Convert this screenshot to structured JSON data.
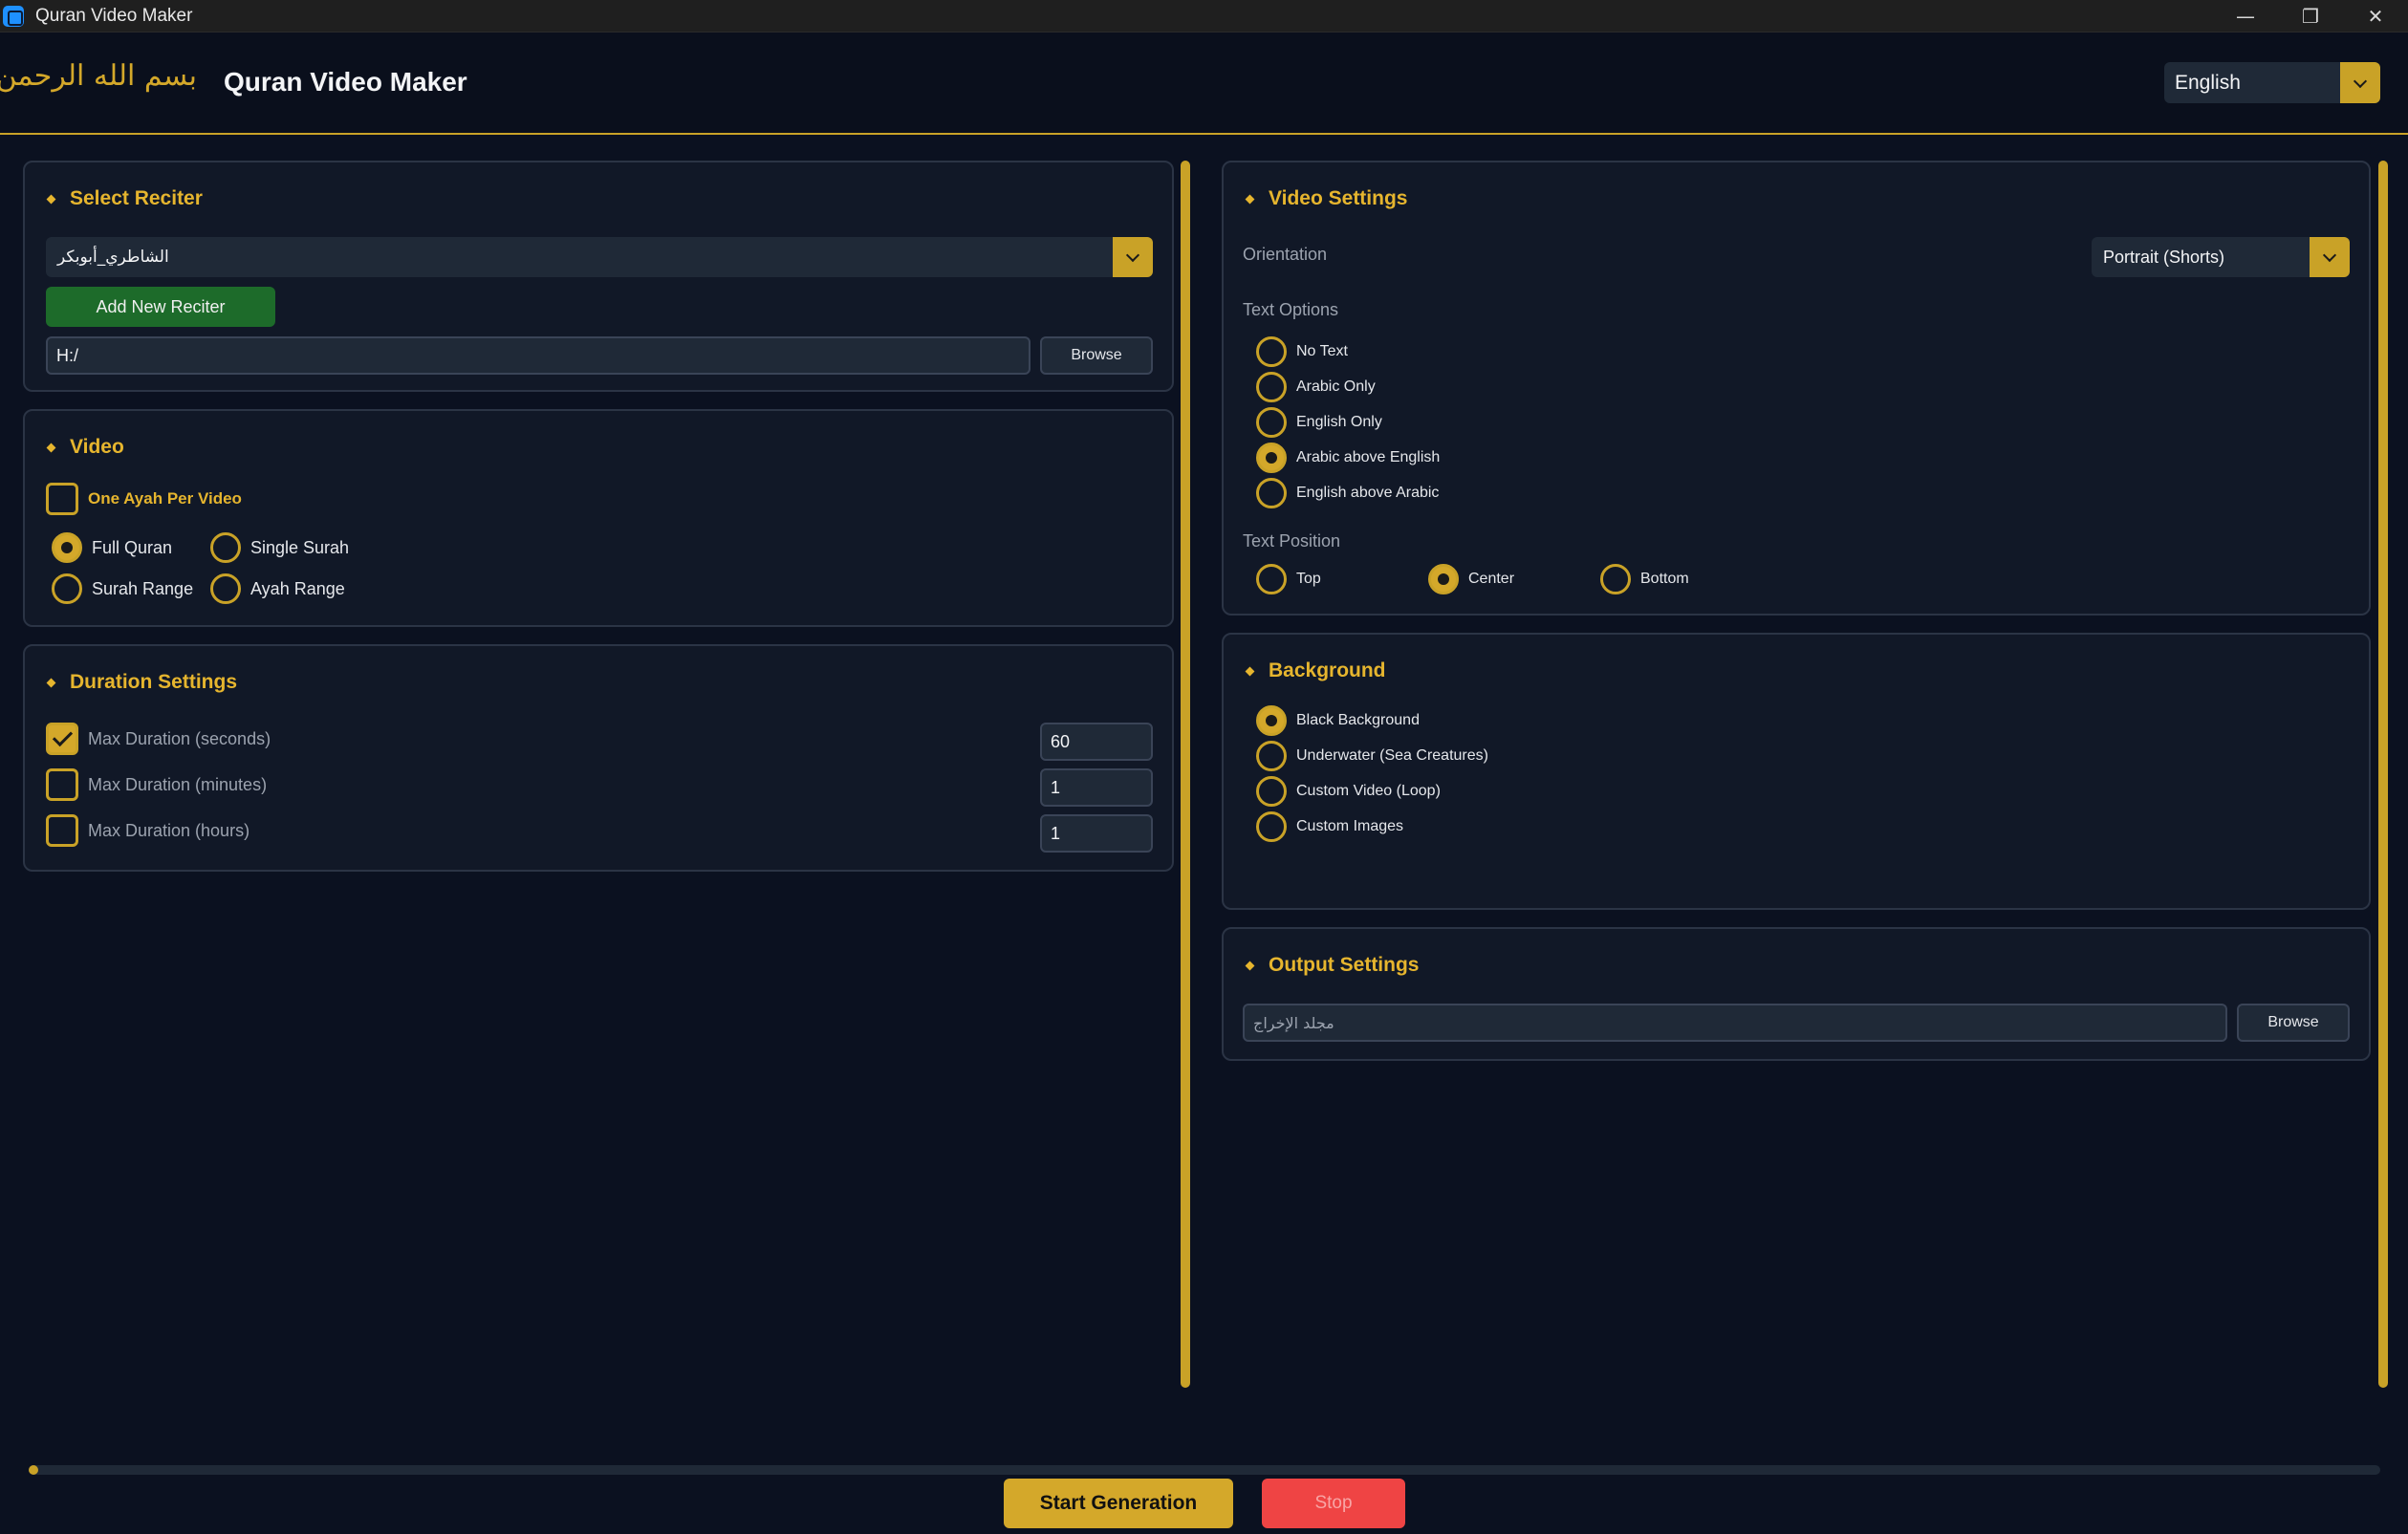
{
  "window": {
    "title": "Quran Video Maker",
    "controls": {
      "minimize": "—",
      "restore": "❐",
      "close": "✕"
    }
  },
  "header": {
    "bismillah": "بسم الله الرحمن الرحيم",
    "title": "Quran Video Maker",
    "language": "English"
  },
  "reciter": {
    "title": "Select Reciter",
    "selected": "الشاطري_أبوبكر",
    "add_button": "Add New Reciter",
    "path": "H:/",
    "browse": "Browse"
  },
  "video": {
    "title": "Video",
    "one_ayah": "One Ayah Per Video",
    "one_ayah_checked": false,
    "modes": [
      {
        "label": "Full Quran",
        "checked": true
      },
      {
        "label": "Single Surah",
        "checked": false
      },
      {
        "label": "Surah Range",
        "checked": false
      },
      {
        "label": "Ayah Range",
        "checked": false
      }
    ]
  },
  "duration": {
    "title": "Duration Settings",
    "rows": [
      {
        "label": "Max Duration (seconds)",
        "checked": true,
        "value": "60"
      },
      {
        "label": "Max Duration (minutes)",
        "checked": false,
        "value": "1"
      },
      {
        "label": "Max Duration (hours)",
        "checked": false,
        "value": "1"
      }
    ]
  },
  "video_settings": {
    "title": "Video Settings",
    "orientation_label": "Orientation",
    "orientation_value": "Portrait (Shorts)",
    "text_options_label": "Text Options",
    "text_options": [
      {
        "label": "No Text",
        "checked": false
      },
      {
        "label": "Arabic Only",
        "checked": false
      },
      {
        "label": "English Only",
        "checked": false
      },
      {
        "label": "Arabic above English",
        "checked": true
      },
      {
        "label": "English above Arabic",
        "checked": false
      }
    ],
    "text_position_label": "Text Position",
    "text_positions": [
      {
        "label": "Top",
        "checked": false
      },
      {
        "label": "Center",
        "checked": true
      },
      {
        "label": "Bottom",
        "checked": false
      }
    ]
  },
  "background": {
    "title": "Background",
    "options": [
      {
        "label": "Black Background",
        "checked": true
      },
      {
        "label": "Underwater (Sea Creatures)",
        "checked": false
      },
      {
        "label": "Custom Video (Loop)",
        "checked": false
      },
      {
        "label": "Custom Images",
        "checked": false
      }
    ]
  },
  "output": {
    "title": "Output Settings",
    "placeholder": "مجلد الإخراج",
    "browse": "Browse"
  },
  "actions": {
    "start": "Start Generation",
    "stop": "Stop"
  },
  "progress": 0,
  "colors": {
    "accent": "#d4a82a",
    "background": "#0b1120",
    "panel": "#111827",
    "green": "#1d6b2a",
    "stop": "#ef4444"
  }
}
